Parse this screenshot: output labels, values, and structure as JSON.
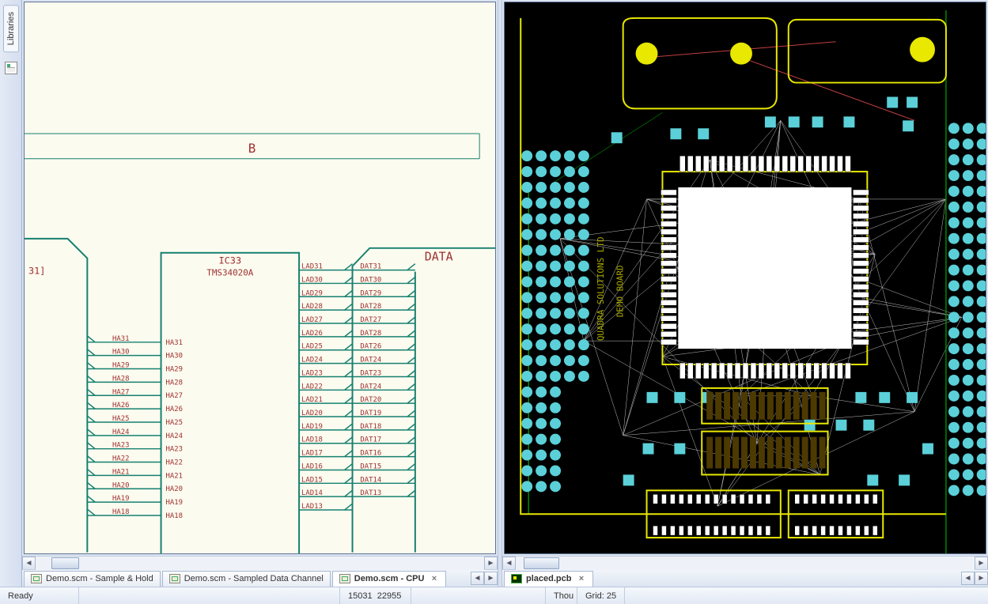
{
  "sidebar": {
    "tab_label": "Libraries"
  },
  "left": {
    "tabs": [
      {
        "label": "Demo.scm - Sample & Hold",
        "active": false
      },
      {
        "label": "Demo.scm - Sampled Data Channel",
        "active": false
      },
      {
        "label": "Demo.scm - CPU",
        "active": true
      }
    ],
    "schematic": {
      "section_letter": "B",
      "bus_label_left": "31]",
      "bus_label_right": "DATA",
      "ic_ref": "IC33",
      "ic_part": "TMS34020A",
      "ha_outer": [
        "HA31",
        "HA30",
        "HA29",
        "HA28",
        "HA27",
        "HA26",
        "HA25",
        "HA24",
        "HA23",
        "HA22",
        "HA21",
        "HA20",
        "HA19",
        "HA18"
      ],
      "ha_inner": [
        "HA31",
        "HA30",
        "HA29",
        "HA28",
        "HA27",
        "HA26",
        "HA25",
        "HA24",
        "HA23",
        "HA22",
        "HA21",
        "HA20",
        "HA19",
        "HA18"
      ],
      "lad": [
        "LAD31",
        "LAD30",
        "LAD29",
        "LAD28",
        "LAD27",
        "LAD26",
        "LAD25",
        "LAD24",
        "LAD23",
        "LAD22",
        "LAD21",
        "LAD20",
        "LAD19",
        "LAD18",
        "LAD17",
        "LAD16",
        "LAD15",
        "LAD14",
        "LAD13"
      ],
      "dat": [
        "DAT31",
        "DAT30",
        "DAT29",
        "DAT28",
        "DAT27",
        "DAT28",
        "DAT26",
        "DAT24",
        "DAT23",
        "DAT24",
        "DAT20",
        "DAT19",
        "DAT18",
        "DAT17",
        "DAT16",
        "DAT15",
        "DAT14",
        "DAT13"
      ]
    }
  },
  "right": {
    "tabs": [
      {
        "label": "placed.pcb",
        "active": true
      }
    ],
    "silk_text1": "QUADRA SOLUTIONS LTD",
    "silk_text2": "DEMO BOARD"
  },
  "status": {
    "ready": "Ready",
    "coord_x": "15031",
    "coord_y": "22955",
    "units": "Thou",
    "grid_label": "Grid:",
    "grid_value": "25"
  }
}
